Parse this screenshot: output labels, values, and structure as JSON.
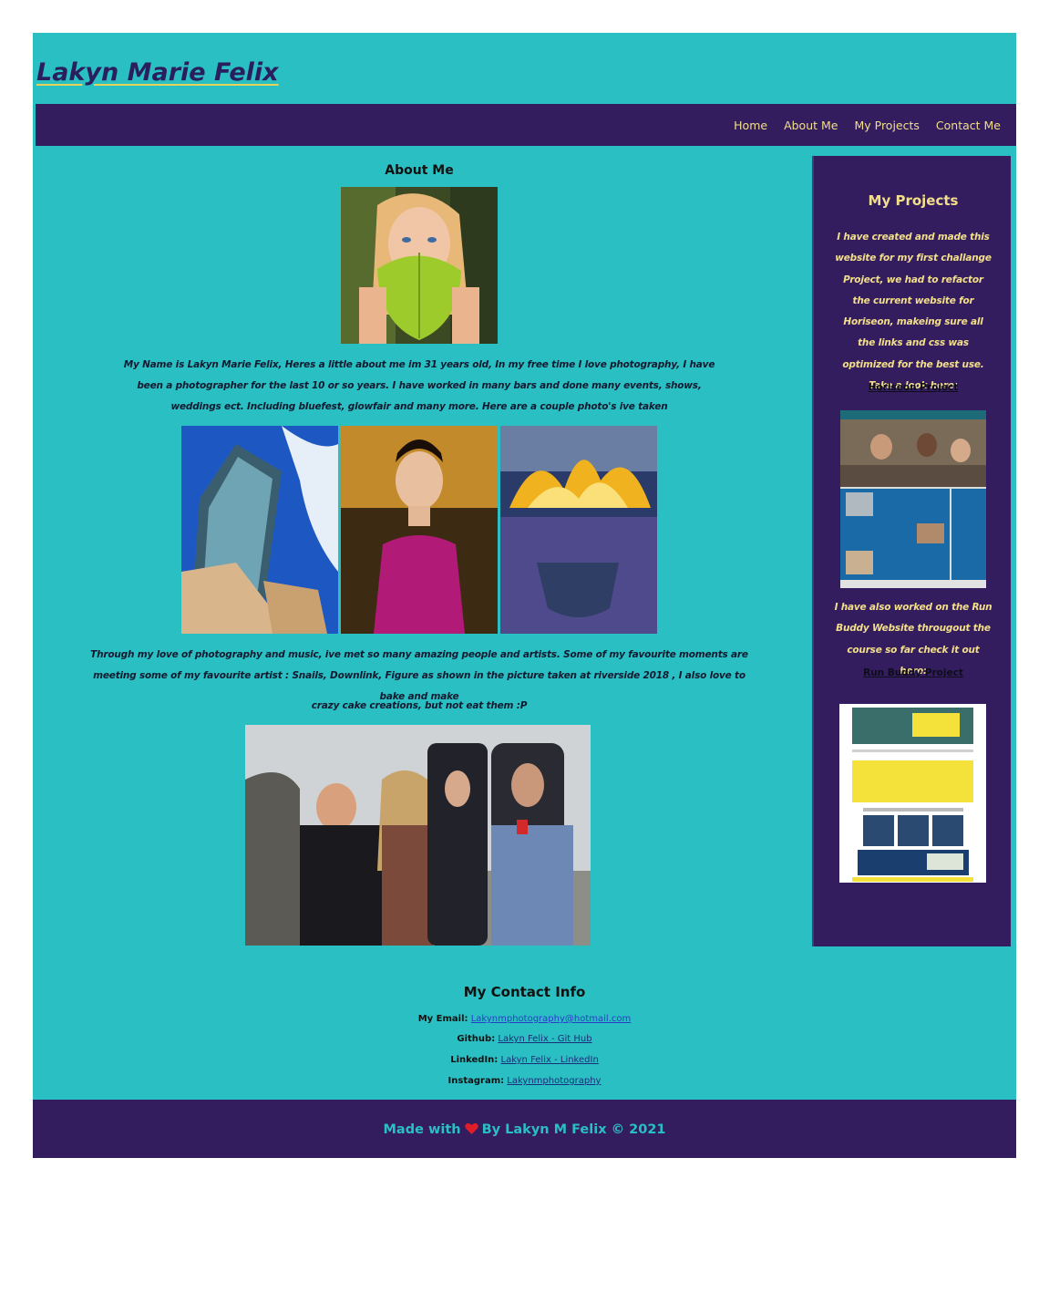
{
  "header": {
    "title": "Lakyn Marie Felix"
  },
  "nav": {
    "items": [
      "Home",
      "About Me",
      "My Projects",
      "Contact Me"
    ]
  },
  "about": {
    "heading": "About Me",
    "paragraph1": "My Name is Lakyn Marie Felix, Heres a little about me im 31 years old, In my free time I love photography, I have been a photographer for the last 10 or so years. I have worked in many bars and done many events, shows, weddings ect. Including bluefest, glowfair and many more. Here are a couple photo's ive taken",
    "paragraph2": "Through my love of photography and music, ive met so many amazing people and artists. Some of my favourite moments are meeting some of my favourite artist : Snails, Downlink, Figure as shown in the picture taken at riverside 2018 , I also love to bake and make",
    "paragraph3": "crazy cake creations, but not eat them :P"
  },
  "sidebar": {
    "title": "My Projects",
    "text1": "I have created and made this website for my first challange Project, we had to refactor the current website for Horiseon, makeing sure all the links and css was optimized for the best use. Take a look here:",
    "link1": "Horiseon Project",
    "text2": "I have also worked on the Run Buddy Website througout the course so far check it out here:",
    "link2": "Run Buddy Project"
  },
  "contact": {
    "heading": "My Contact Info",
    "rows": [
      {
        "label": "My Email:",
        "value": "Lakynmphotography@hotmail.com"
      },
      {
        "label": "Github:",
        "value": "Lakyn Felix - Git Hub"
      },
      {
        "label": "LinkedIn:",
        "value": "Lakyn Felix - LinkedIn"
      },
      {
        "label": "Instagram:",
        "value": "Lakynmphotography"
      }
    ]
  },
  "footer": {
    "prefix": "Made with",
    "suffix": "By Lakyn M Felix © 2021",
    "icon": "heart-icon"
  },
  "colors": {
    "background": "#2abfc3",
    "nav": "#331d5e",
    "accent": "#f3df8a",
    "title": "#2a1f5e"
  }
}
